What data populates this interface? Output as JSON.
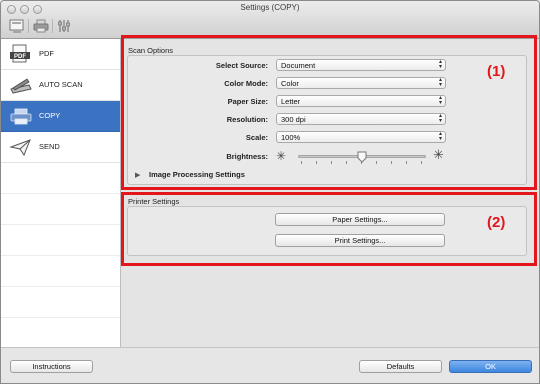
{
  "window": {
    "title": "Settings (COPY)"
  },
  "toolbar": {
    "icons": [
      "scan-tab-icon",
      "printer-tab-icon",
      "general-settings-icon"
    ]
  },
  "sidebar": {
    "items": [
      {
        "label": "PDF",
        "icon": "pdf-icon",
        "selected": false
      },
      {
        "label": "AUTO SCAN",
        "icon": "auto-scan-icon",
        "selected": false
      },
      {
        "label": "COPY",
        "icon": "copy-icon",
        "selected": true
      },
      {
        "label": "SEND",
        "icon": "send-icon",
        "selected": false
      }
    ]
  },
  "scan_options": {
    "title": "Scan Options",
    "rows": [
      {
        "label": "Select Source:",
        "value": "Document"
      },
      {
        "label": "Color Mode:",
        "value": "Color"
      },
      {
        "label": "Paper Size:",
        "value": "Letter"
      },
      {
        "label": "Resolution:",
        "value": "300 dpi"
      },
      {
        "label": "Scale:",
        "value": "100%"
      }
    ],
    "brightness_label": "Brightness:",
    "brightness_level": 0.5,
    "image_processing_label": "Image Processing Settings"
  },
  "printer_settings": {
    "title": "Printer Settings",
    "paper_settings_button": "Paper Settings...",
    "print_settings_button": "Print Settings..."
  },
  "callouts": {
    "one": "(1)",
    "two": "(2)"
  },
  "footer": {
    "instructions_button": "Instructions",
    "defaults_button": "Defaults",
    "ok_button": "OK"
  },
  "colors": {
    "accent": "#3c72c2",
    "callout": "#e3161c",
    "ok_button": "#3d86df"
  }
}
